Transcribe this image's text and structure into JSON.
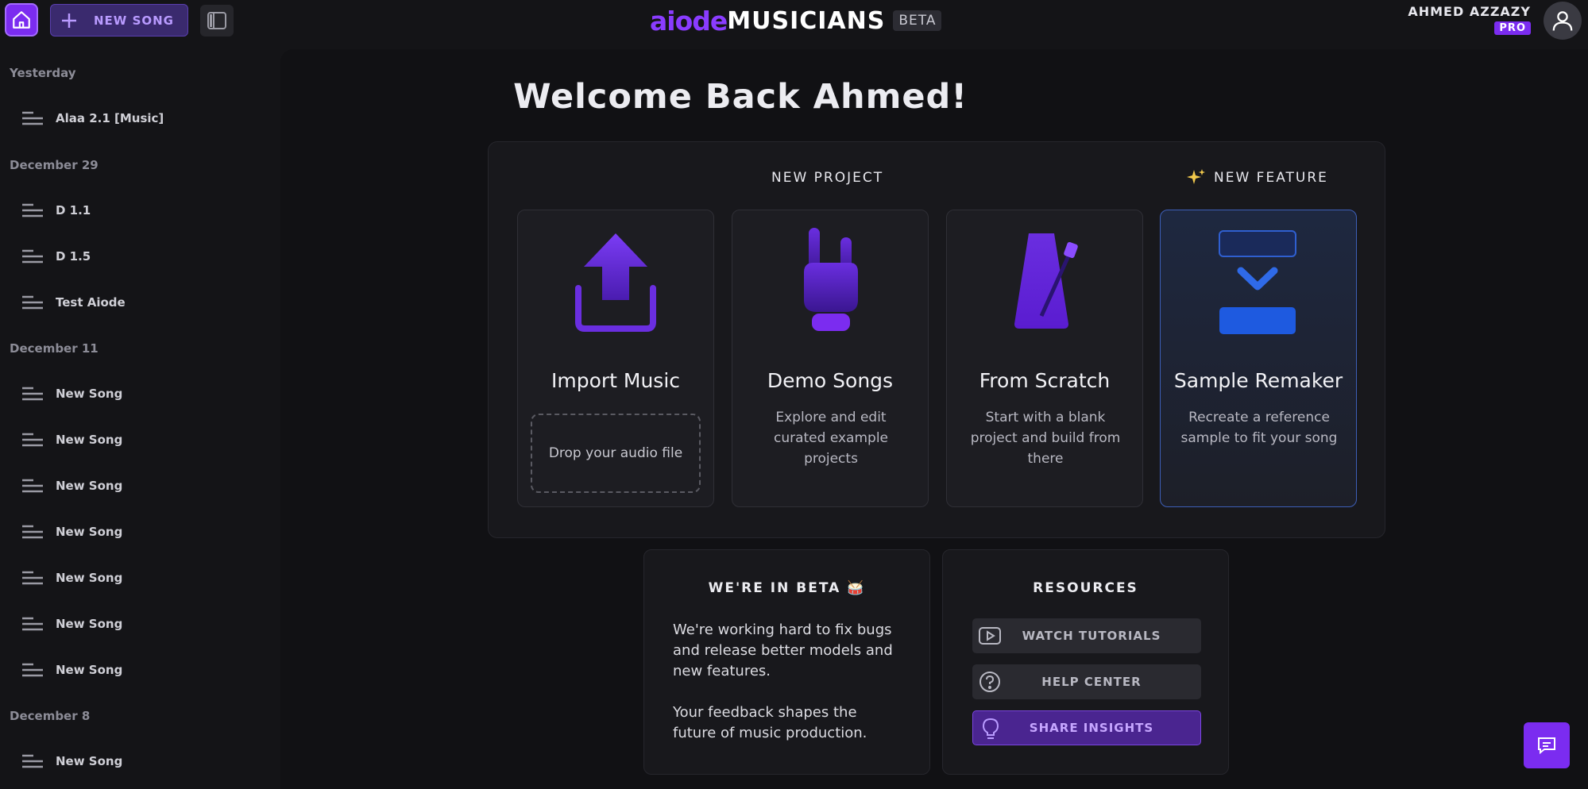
{
  "topbar": {
    "new_song_label": "NEW SONG",
    "logo_aiode": "aiode",
    "logo_musicians": "MUSICIANS",
    "beta_badge": "BETA",
    "user_name": "AHMED AZZAZY",
    "plan_badge": "PRO"
  },
  "sidebar": {
    "groups": [
      {
        "label": "Yesterday",
        "items": [
          "Alaa 2.1 [Music]"
        ]
      },
      {
        "label": "December 29",
        "items": [
          "D 1.1",
          "D 1.5",
          "Test Aiode"
        ]
      },
      {
        "label": "December 11",
        "items": [
          "New Song",
          "New Song",
          "New Song",
          "New Song",
          "New Song",
          "New Song",
          "New Song"
        ]
      },
      {
        "label": "December 8",
        "items": [
          "New Song"
        ]
      }
    ]
  },
  "main": {
    "welcome": "Welcome Back  Ahmed!",
    "new_project_label": "NEW PROJECT",
    "new_feature_label": "NEW FEATURE",
    "new_feature_icon": "sparkles-icon",
    "cards": [
      {
        "title": "Import Music",
        "dropzone": "Drop your audio file",
        "icon": "upload-icon"
      },
      {
        "title": "Demo Songs",
        "description": "Explore and edit curated example projects",
        "icon": "rock-hand-icon"
      },
      {
        "title": "From Scratch",
        "description": "Start with a blank project and build from there",
        "icon": "metronome-icon"
      },
      {
        "title": "Sample Remaker",
        "description": "Recreate a reference sample to fit your song",
        "icon": "remake-icon"
      }
    ],
    "beta_panel": {
      "title": "WE'RE IN BETA 🥁",
      "paragraph1": "We're working hard to fix bugs and release better models and new features.",
      "paragraph2": "Your feedback shapes the future of music production."
    },
    "resources": {
      "title": "RESOURCES",
      "watch": "WATCH TUTORIALS",
      "help": "HELP CENTER",
      "share": "SHARE INSIGHTS"
    }
  },
  "colors": {
    "accent": "#7b2cf0",
    "background": "#111114",
    "feature_blue": "#1e5ae0"
  }
}
